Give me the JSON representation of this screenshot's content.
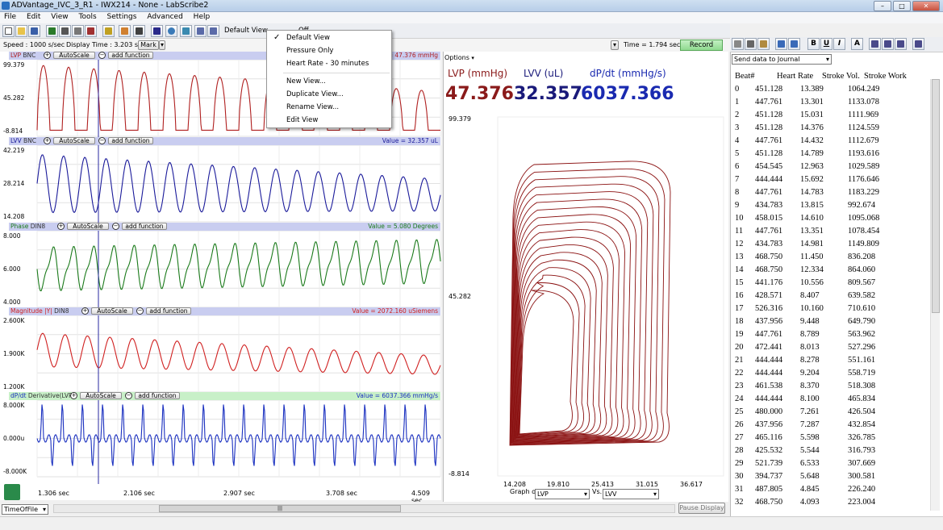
{
  "window": {
    "title": "ADVantage_IVC_3_R1 - IWX214 - None - LabScribe2"
  },
  "menus": [
    "File",
    "Edit",
    "View",
    "Tools",
    "Settings",
    "Advanced",
    "Help"
  ],
  "toolbar": {
    "view_label": "Default View",
    "offscreen_label": "Off",
    "record_label": "Record"
  },
  "view_menu": {
    "items": [
      "Default View",
      "Pressure Only",
      "Heart Rate - 30 minutes",
      "New View...",
      "Duplicate View...",
      "Rename View...",
      "Edit View"
    ],
    "checked": "Default View"
  },
  "speed": {
    "speed": "Speed : 1000 s/sec",
    "display": "Display Time : 3.203 sec",
    "mark": "Mark",
    "time": "Time = 1.794 sec"
  },
  "channels": [
    {
      "name": "LVP",
      "src": "BNC",
      "value": "= 47.376 mmHg",
      "ymax": "99.379",
      "ymid": "45.282",
      "ymin": "-8.814",
      "color": "#b02020",
      "head_bg": "#c9cdf0",
      "val_color": "#b02020"
    },
    {
      "name": "LVV",
      "src": "BNC",
      "value": "Value = 32.357 uL",
      "ymax": "42.219",
      "ymid": "28.214",
      "ymin": "14.208",
      "color": "#1a1a9a",
      "head_bg": "#c9cdf0",
      "val_color": "#1a1a9a"
    },
    {
      "name": "Phase",
      "src": "DIN8",
      "value": "Value = 5.080 Degrees",
      "ymax": "8.000",
      "ymid": "6.000",
      "ymin": "4.000",
      "color": "#1a7a1a",
      "head_bg": "#c9cdf0",
      "val_color": "#1a7a1a"
    },
    {
      "name": "Magnitude |Y|",
      "src": "DIN8",
      "value": "Value = 2072.160 uSiemens",
      "ymax": "2.600K",
      "ymid": "1.900K",
      "ymin": "1.200K",
      "color": "#d02020",
      "head_bg": "#c9cdf0",
      "val_color": "#d02020"
    },
    {
      "name": "dP/dt",
      "src": "Derivative(LVP)",
      "value": "Value = 6037.366 mmHg/s",
      "ymax": "8.000K",
      "ymid": "0.000u",
      "ymin": "-8.000K",
      "color": "#1a30c0",
      "head_bg": "#c8f0c8",
      "val_color": "#1a30c0"
    }
  ],
  "channel_buttons": {
    "autoscale": "AutoScale",
    "add": "add function"
  },
  "time_axis": [
    "1.306 sec",
    "2.106 sec",
    "2.907 sec",
    "3.708 sec",
    "4.509 sec"
  ],
  "xy": {
    "options": "Options",
    "name_lvp": "LVP (mmHg)",
    "name_lvv": "LVV (uL)",
    "name_dpdt": "dP/dt (mmHg/s)",
    "val_lvp": "47.376",
    "val_lvv": "32.357",
    "val_dpdt": "6037.366",
    "ymax": "99.379",
    "ymid": "45.282",
    "ymin": "-8.814",
    "xticks": [
      "14.208",
      "19.810",
      "25.413",
      "31.015",
      "36.617"
    ],
    "graph_of": "Graph of",
    "graph_sel": "LVP",
    "vs": "Vs.",
    "vs_sel": "LVV"
  },
  "status": {
    "timeoffile": "TimeOfFile",
    "pause": "Pause Display"
  },
  "journal": {
    "send": "Send data to Journal",
    "headers": [
      "Beat#",
      "Heart Rate",
      "Stroke Vol.",
      "Stroke Work"
    ],
    "rows": [
      [
        "0",
        "451.128",
        "13.389",
        "1064.249"
      ],
      [
        "1",
        "447.761",
        "13.301",
        "1133.078"
      ],
      [
        "2",
        "451.128",
        "15.031",
        "1111.969"
      ],
      [
        "3",
        "451.128",
        "14.376",
        "1124.559"
      ],
      [
        "4",
        "447.761",
        "14.432",
        "1112.679"
      ],
      [
        "5",
        "451.128",
        "14.789",
        "1193.616"
      ],
      [
        "6",
        "454.545",
        "12.963",
        "1029.589"
      ],
      [
        "7",
        "444.444",
        "15.692",
        "1176.646"
      ],
      [
        "8",
        "447.761",
        "14.783",
        "1183.229"
      ],
      [
        "9",
        "434.783",
        "13.815",
        "992.674"
      ],
      [
        "10",
        "458.015",
        "14.610",
        "1095.068"
      ],
      [
        "11",
        "447.761",
        "13.351",
        "1078.454"
      ],
      [
        "12",
        "434.783",
        "14.981",
        "1149.809"
      ],
      [
        "13",
        "468.750",
        "11.450",
        "836.208"
      ],
      [
        "14",
        "468.750",
        "12.334",
        "864.060"
      ],
      [
        "15",
        "441.176",
        "10.556",
        "809.567"
      ],
      [
        "16",
        "428.571",
        "8.407",
        "639.582"
      ],
      [
        "17",
        "526.316",
        "10.160",
        "710.610"
      ],
      [
        "18",
        "437.956",
        "9.448",
        "649.790"
      ],
      [
        "19",
        "447.761",
        "8.789",
        "563.962"
      ],
      [
        "20",
        "472.441",
        "8.013",
        "527.296"
      ],
      [
        "21",
        "444.444",
        "8.278",
        "551.161"
      ],
      [
        "22",
        "444.444",
        "9.204",
        "558.719"
      ],
      [
        "23",
        "461.538",
        "8.370",
        "518.308"
      ],
      [
        "24",
        "444.444",
        "8.100",
        "465.834"
      ],
      [
        "25",
        "480.000",
        "7.261",
        "426.504"
      ],
      [
        "26",
        "437.956",
        "7.287",
        "432.854"
      ],
      [
        "27",
        "465.116",
        "5.598",
        "326.785"
      ],
      [
        "28",
        "425.532",
        "5.544",
        "316.793"
      ],
      [
        "29",
        "521.739",
        "6.533",
        "307.669"
      ],
      [
        "30",
        "394.737",
        "5.648",
        "300.581"
      ],
      [
        "31",
        "487.805",
        "4.845",
        "226.240"
      ],
      [
        "32",
        "468.750",
        "4.093",
        "223.004"
      ]
    ]
  }
}
